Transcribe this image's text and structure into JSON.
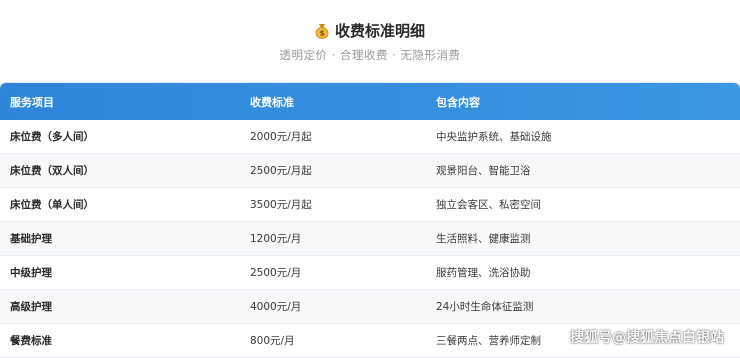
{
  "header": {
    "icon": "money-bag-icon",
    "title": "收费标准明细",
    "subtitle": "透明定价 · 合理收费 · 无隐形消费"
  },
  "table": {
    "columns": [
      "服务项目",
      "收费标准",
      "包含内容"
    ],
    "rows": [
      {
        "service": "床位费（多人间）",
        "price": "2000元/月起",
        "includes": "中央监护系统、基础设施"
      },
      {
        "service": "床位费（双人间）",
        "price": "2500元/月起",
        "includes": "观景阳台、智能卫浴"
      },
      {
        "service": "床位费（单人间）",
        "price": "3500元/月起",
        "includes": "独立会客区、私密空间"
      },
      {
        "service": "基础护理",
        "price": "1200元/月",
        "includes": "生活照料、健康监测"
      },
      {
        "service": "中级护理",
        "price": "2500元/月",
        "includes": "服药管理、洗浴协助"
      },
      {
        "service": "高级护理",
        "price": "4000元/月",
        "includes": "24小时生命体征监测"
      },
      {
        "service": "餐费标准",
        "price": "800元/月",
        "includes": "三餐两点、营养师定制"
      }
    ]
  },
  "watermark": "搜狐号@搜狐焦点白银站",
  "colors": {
    "header_blue": "#2f86d9",
    "stripe": "#f6f8fa"
  }
}
